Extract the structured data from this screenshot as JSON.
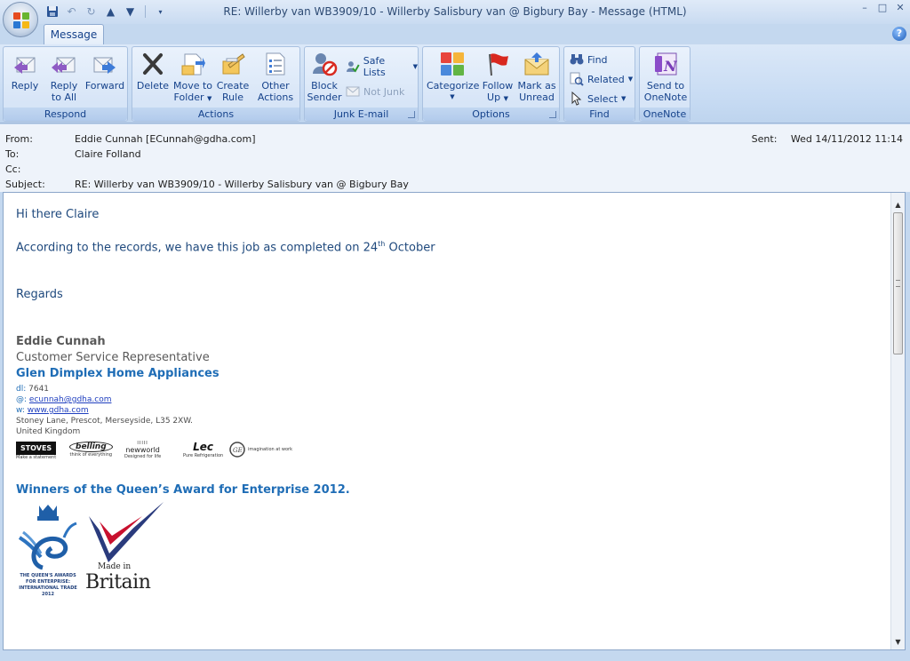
{
  "window": {
    "title": "RE: Willerby van WB3909/10 - Willerby Salisbury van @ Bigbury Bay  - Message (HTML)"
  },
  "ribbon": {
    "tab": "Message",
    "groups": {
      "respond": {
        "label": "Respond",
        "reply": "Reply",
        "reply_all_1": "Reply",
        "reply_all_2": "to All",
        "forward": "Forward"
      },
      "actions": {
        "label": "Actions",
        "delete": "Delete",
        "move_1": "Move to",
        "move_2": "Folder",
        "create_1": "Create",
        "create_2": "Rule",
        "other_1": "Other",
        "other_2": "Actions"
      },
      "junk": {
        "label": "Junk E-mail",
        "block_1": "Block",
        "block_2": "Sender",
        "safe_lists": "Safe Lists",
        "not_junk": "Not Junk"
      },
      "options": {
        "label": "Options",
        "categorize": "Categorize",
        "follow_1": "Follow",
        "follow_2": "Up",
        "mark_1": "Mark as",
        "mark_2": "Unread"
      },
      "find": {
        "label": "Find",
        "find": "Find",
        "related": "Related",
        "select": "Select"
      },
      "onenote": {
        "label": "OneNote",
        "send_1": "Send to",
        "send_2": "OneNote"
      }
    }
  },
  "header": {
    "from_label": "From:",
    "from_value": "Eddie Cunnah [ECunnah@gdha.com]",
    "to_label": "To:",
    "to_value": "Claire Folland",
    "cc_label": "Cc:",
    "subject_label": "Subject:",
    "subject_value": "RE: Willerby van WB3909/10 - Willerby Salisbury van @ Bigbury Bay",
    "sent_label": "Sent:",
    "sent_value": "Wed 14/11/2012 11:14"
  },
  "message": {
    "greeting": "Hi there Claire",
    "line1_before": "According to the records, we have this job as completed on 24",
    "line1_sup": "th",
    "line1_after": " October",
    "regards": "Regards",
    "sig_name": "Eddie Cunnah",
    "sig_role": "Customer Service Representative",
    "sig_company": "Glen Dimplex Home Appliances",
    "dl_label": "dl:",
    "dl_value": " 7641",
    "email_label": "@:",
    "email_value": "ecunnah@gdha.com",
    "web_label": "w:",
    "web_value": "www.gdha.com",
    "address": "Stoney Lane, Prescot, Merseyside, L35 2XW.",
    "country": "United Kingdom",
    "brands": {
      "stoves": "STOVES",
      "stoves_tag": "Make a statement",
      "belling": "belling",
      "belling_tag": "think of everything",
      "newworld": "newworld",
      "newworld_tag": "Designed for life",
      "lec": "Lec",
      "lec_tag": "Pure Refrigeration",
      "ge_tag": "imagination at work"
    },
    "award": "Winners of the Queen’s Award for Enterprise 2012.",
    "queens_award_1": "THE QUEEN'S AWARDS",
    "queens_award_2": "FOR ENTERPRISE:",
    "queens_award_3": "INTERNATIONAL TRADE",
    "queens_award_4": "2012",
    "made_in": "Made in",
    "britain": "Britain"
  }
}
